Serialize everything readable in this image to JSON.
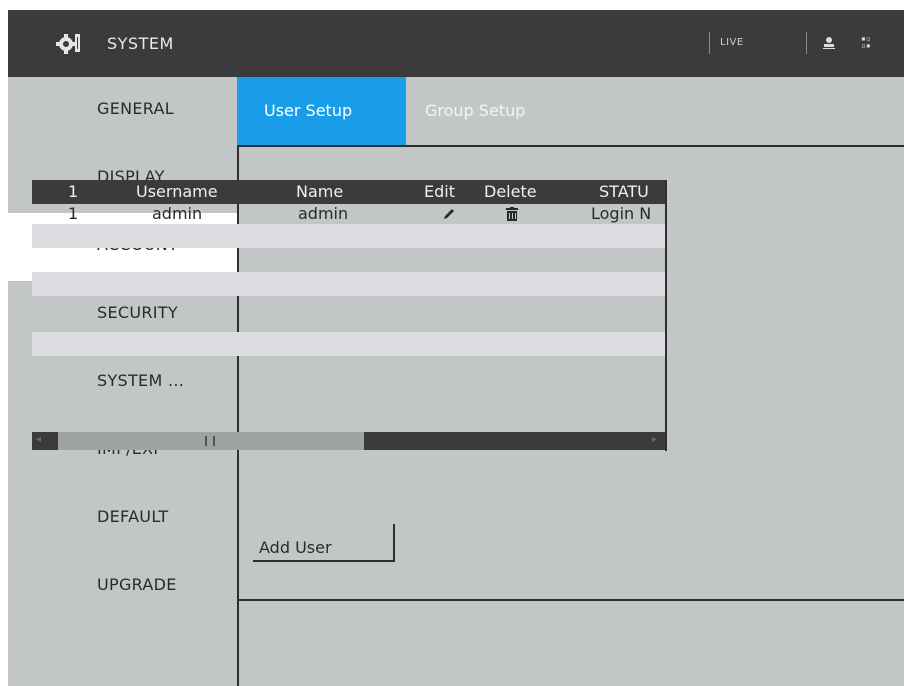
{
  "header": {
    "title": "SYSTEM",
    "live_label": "LIVE",
    "icons": [
      "gear-icon",
      "user-icon",
      "shortcut-icon"
    ]
  },
  "sidebar": {
    "items": [
      {
        "label": "GENERAL"
      },
      {
        "label": "DISPLAY"
      },
      {
        "label": "ACCOUNT",
        "active": true,
        "marker": ">"
      },
      {
        "label": "SECURITY"
      },
      {
        "label": "SYSTEM ..."
      },
      {
        "label": "IMP/EXP"
      },
      {
        "label": "DEFAULT"
      },
      {
        "label": "UPGRADE"
      }
    ]
  },
  "tabs": [
    {
      "label": "User Setup",
      "active": true
    },
    {
      "label": "Group Setup",
      "active": false
    }
  ],
  "table": {
    "headers": [
      "1",
      "Username",
      "Name",
      "Edit",
      "Delete",
      "STATU"
    ],
    "rows": [
      {
        "index": "1",
        "username": "admin",
        "name": "admin",
        "edit_icon": "edit-icon",
        "delete_icon": "trash-icon",
        "status": "Login N"
      }
    ]
  },
  "actions": {
    "add_user_label": "Add User"
  },
  "colors": {
    "accent": "#1a9de8",
    "topbar": "#3b3a3c",
    "background": "#c2c6c7",
    "row_light": "#dcdbe0"
  }
}
